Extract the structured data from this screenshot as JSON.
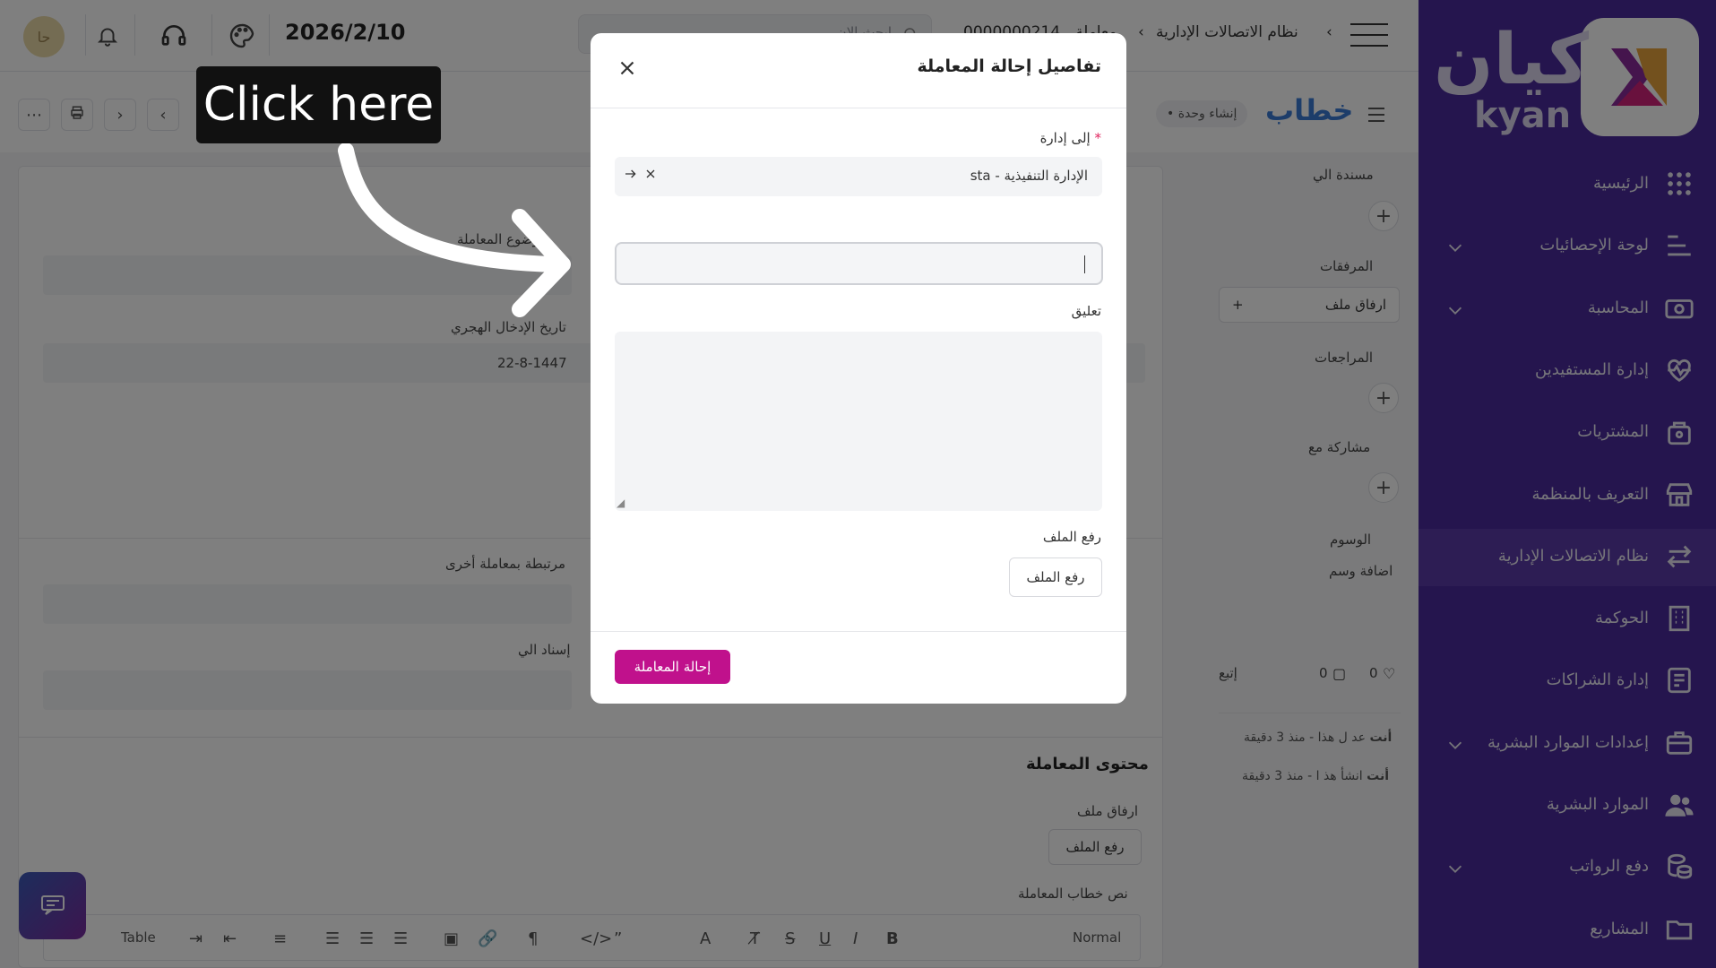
{
  "topbar": {
    "date": "2026/2/10",
    "avatar_initials": "حا",
    "search_placeholder": "ابحث الان",
    "breadcrumb": [
      "نظام الاتصالات الإدارية",
      "معاملة",
      "0000000214"
    ]
  },
  "subbar": {
    "page_title": "خطاب",
    "unit_pill": "إنشاء وحدة"
  },
  "form": {
    "subject_label": "موضوع المعاملة",
    "hijri_label": "تاريخ الإدخال الهجري",
    "hijri_value": "22-8-1447",
    "linked_label": "مرتبطة بمعاملة أخرى",
    "assign_label": "إسناد الي",
    "content_title": "محتوى المعاملة",
    "attach_label": "ارفاق ملف",
    "upload_button": "رفع الملف",
    "letter_text_label": "نص خطاب المعاملة",
    "editor": {
      "style": "Normal",
      "table": "Table"
    }
  },
  "side": {
    "assigned_label": "مسندة الي",
    "attachments_label": "المرفقات",
    "attach_button": "ارفاق ملف",
    "reviews_label": "المراجعات",
    "shared_label": "مشاركة مع",
    "tags_label": "الوسوم",
    "add_tag": "اضافة وسم",
    "likes": "0",
    "comments": "0",
    "follow": "إتبع",
    "activity": [
      {
        "who": "أنت",
        "text": "عد ل هذا - منذ 3 دقيقة"
      },
      {
        "who": "أنت",
        "text": "انشأ هذ ا - منذ 3 دقيقة"
      }
    ]
  },
  "sidebar": {
    "logo_ar": "كيان",
    "logo_en": "kyan",
    "items": [
      {
        "label": "الرئيسية",
        "icon": "grid-icon",
        "chevron": false,
        "active": false
      },
      {
        "label": "لوحة الإحصائيات",
        "icon": "stats-icon",
        "chevron": true,
        "active": false
      },
      {
        "label": "المحاسبة",
        "icon": "money-icon",
        "chevron": true,
        "active": false
      },
      {
        "label": "إدارة المستفيدين",
        "icon": "heart-pulse-icon",
        "chevron": false,
        "active": false
      },
      {
        "label": "المشتريات",
        "icon": "bag-icon",
        "chevron": false,
        "active": false
      },
      {
        "label": "التعريف بالمنظمة",
        "icon": "store-icon",
        "chevron": false,
        "active": false
      },
      {
        "label": "نظام الاتصالات الإدارية",
        "icon": "exchange-icon",
        "chevron": false,
        "active": true
      },
      {
        "label": "الحوكمة",
        "icon": "building-icon",
        "chevron": false,
        "active": false
      },
      {
        "label": "إدارة الشراكات",
        "icon": "document-icon",
        "chevron": false,
        "active": false
      },
      {
        "label": "إعدادات الموارد البشرية",
        "icon": "briefcase-icon",
        "chevron": true,
        "active": false
      },
      {
        "label": "الموارد البشرية",
        "icon": "users-icon",
        "chevron": false,
        "active": false
      },
      {
        "label": "دفع الرواتب",
        "icon": "coins-icon",
        "chevron": true,
        "active": false
      },
      {
        "label": "المشاريع",
        "icon": "folder-icon",
        "chevron": false,
        "active": false
      }
    ]
  },
  "modal": {
    "title": "تفاصيل إحالة المعاملة",
    "to_department_label": "إلى إدارة",
    "to_department_value": "الإدارة التنفيذية - sta",
    "comment_label": "تعليق",
    "upload_label": "رفع الملف",
    "upload_button": "رفع الملف",
    "submit_button": "إحالة المعاملة"
  },
  "callout": {
    "text": "Click here"
  },
  "colors": {
    "sidebar": "#4a2b9c",
    "accent": "#c0118c",
    "title_blue": "#3a7bd5"
  }
}
